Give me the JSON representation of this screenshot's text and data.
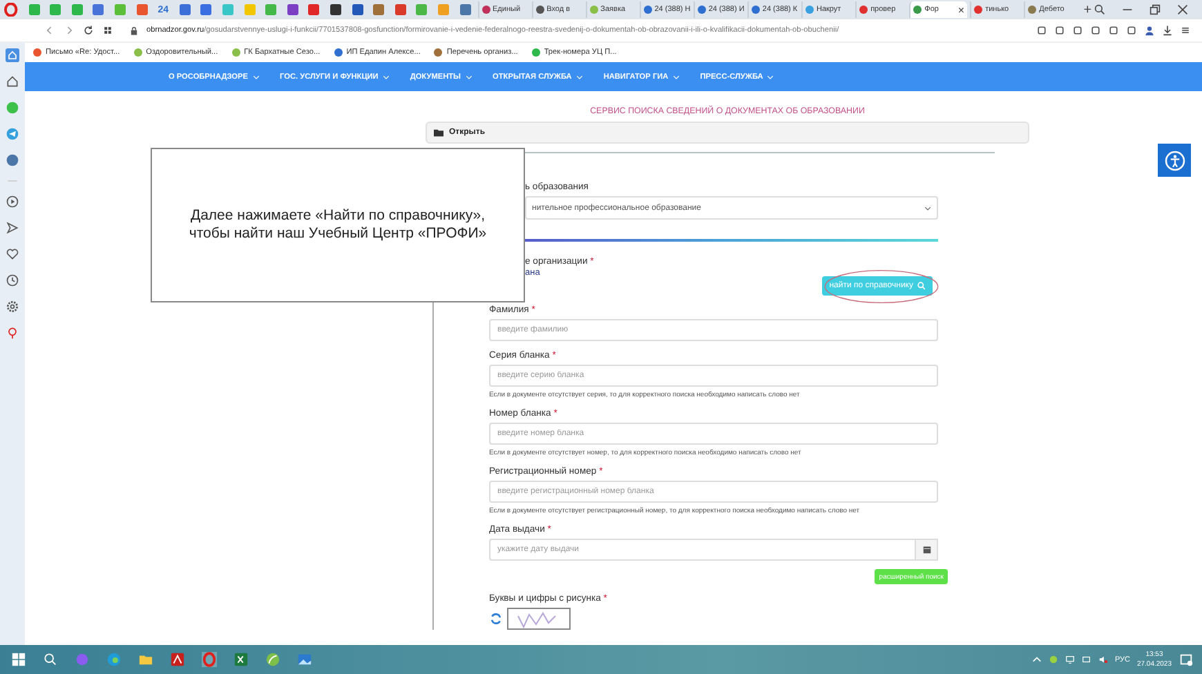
{
  "browser": {
    "pinned_tabs": [
      {
        "kind": "icon",
        "color": "#2eb84b"
      },
      {
        "kind": "icon",
        "color": "#2eb84b"
      },
      {
        "kind": "icon",
        "color": "#2eb84b"
      },
      {
        "kind": "icon",
        "color": "#4a73d9"
      },
      {
        "kind": "icon",
        "color": "#5bbf3a"
      },
      {
        "kind": "icon",
        "color": "#e8552e"
      },
      {
        "kind": "text",
        "label": "24"
      },
      {
        "kind": "icon",
        "color": "#3d6fd8"
      },
      {
        "kind": "icon",
        "color": "#3b6ee0"
      },
      {
        "kind": "icon",
        "color": "#38c6c6"
      },
      {
        "kind": "icon",
        "color": "#f2c600"
      },
      {
        "kind": "icon",
        "color": "#45b84a"
      },
      {
        "kind": "icon",
        "color": "#7b3fc4"
      },
      {
        "kind": "icon",
        "color": "#e02828"
      },
      {
        "kind": "icon",
        "color": "#333333"
      },
      {
        "kind": "icon",
        "color": "#2357b8"
      },
      {
        "kind": "icon",
        "color": "#a0703a"
      },
      {
        "kind": "icon",
        "color": "#d93a2a"
      },
      {
        "kind": "icon",
        "color": "#4cb848"
      },
      {
        "kind": "icon",
        "color": "#f0a020"
      },
      {
        "kind": "icon",
        "color": "#4a76a8"
      }
    ],
    "tabs": [
      {
        "title": "Единый",
        "color": "#c0305a",
        "selected": false
      },
      {
        "title": "Вход в",
        "color": "#555555",
        "selected": false
      },
      {
        "title": "Заявка",
        "color": "#8ac04a",
        "selected": false
      },
      {
        "title": "24 (388) Н",
        "color": "#2f6fd0",
        "selected": false
      },
      {
        "title": "24 (388) И",
        "color": "#2f6fd0",
        "selected": false
      },
      {
        "title": "24 (388) К",
        "color": "#2f6fd0",
        "selected": false
      },
      {
        "title": "Накрут",
        "color": "#3aa0e0",
        "selected": false
      },
      {
        "title": "провер",
        "color": "#e03030",
        "selected": false
      },
      {
        "title": "Фор",
        "color": "#3a9a4a",
        "selected": true
      },
      {
        "title": "тинько",
        "color": "#e03030",
        "selected": false
      },
      {
        "title": "Дебето",
        "color": "#8a7a50",
        "selected": false
      }
    ],
    "tab_close": "×",
    "new_tab": "+",
    "address": "**obrnadzor.gov.ru**/gosudarstvennye-uslugi-i-funkcii/7701537808-gosfunction/formirovanie-i-vedenie-federalnogo-reestra-svedenij-o-dokumentah-ob-obrazovanii-i-ili-o-kvalifikacii-dokumentah-ob-obuchenii/",
    "bookmarks": [
      {
        "label": "Письмо «Re: Удост...",
        "color": "#e8552e"
      },
      {
        "label": "Оздоровительный...",
        "color": "#8ac04a"
      },
      {
        "label": "ГК Бархатные Сезо...",
        "color": "#8ac04a"
      },
      {
        "label": "ИП Едапин Алексе...",
        "color": "#2f6fd0"
      },
      {
        "label": "Перечень организ...",
        "color": "#a0703a"
      },
      {
        "label": "Трек-номера УЦ П...",
        "color": "#2eb84b"
      }
    ]
  },
  "nav": [
    "О РОСОБРНАДЗОРЕ",
    "ГОС. УСЛУГИ И ФУНКЦИИ",
    "ДОКУМЕНТЫ",
    "ОТКРЫТАЯ СЛУЖБА",
    "НАВИГАТОР ГИА",
    "ПРЕСС-СЛУЖБА"
  ],
  "page_title": "СЕРВИС ПОИСКА СВЕДЕНИЙ О ДОКУМЕНТАХ ОБ ОБРАЗОВАНИИ",
  "panel_header": "Открыть",
  "form": {
    "level_label": "ь образования",
    "level_value": "нительное профессиональное образование",
    "org_label": "е организации",
    "org_mark": "*",
    "org_value": "ана",
    "find_button": "найти по справочнику",
    "fields": [
      {
        "label": "Фамилия",
        "mark": "*",
        "placeholder": "введите фамилию"
      },
      {
        "label": "Серия бланка",
        "mark": "*",
        "placeholder": "введите серию бланка",
        "hint": "Если в документе отсутствует серия, то для корректного поиска необходимо написать слово нет"
      },
      {
        "label": "Номер бланка",
        "mark": "*",
        "placeholder": "введите номер бланка",
        "hint": "Если в документе отсутствует номер, то для корректного поиска необходимо написать слово нет"
      },
      {
        "label": "Регистрационный номер",
        "mark": "*",
        "placeholder": "введите регистрационный номер бланка",
        "hint": "Если в документе отсутствует регистрационный номер, то для корректного поиска необходимо написать слово нет"
      }
    ],
    "date": {
      "label": "Дата выдачи",
      "mark": "*",
      "placeholder": "укажите дату выдачи"
    },
    "advanced_button": "расширенный поиск",
    "captcha_label": "Буквы и цифры с рисунка",
    "captcha_mark": "*"
  },
  "overlay_note": "Далее нажимаете «Найти по справочнику», чтобы найти наш Учебный Центр «ПРОФИ»",
  "taskbar": {
    "language": "РУС",
    "time": "13:53",
    "date": "27.04.2023"
  }
}
